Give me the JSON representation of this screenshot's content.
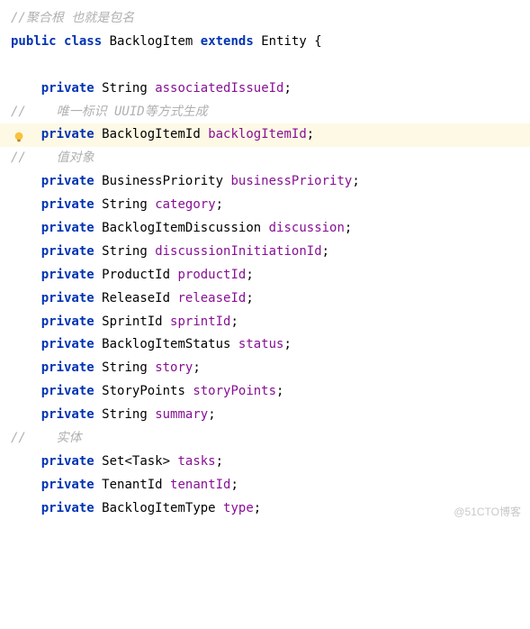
{
  "comments": {
    "line1": "//聚合根 也就是包名",
    "line2": "//    唯一标识 UUID等方式生成",
    "line3": "//    值对象",
    "line4": "//    实体"
  },
  "keywords": {
    "public": "public",
    "class": "class",
    "extends": "extends",
    "private": "private"
  },
  "types": {
    "String": "String",
    "BacklogItemId": "BacklogItemId",
    "BusinessPriority": "BusinessPriority",
    "BacklogItemDiscussion": "BacklogItemDiscussion",
    "ProductId": "ProductId",
    "ReleaseId": "ReleaseId",
    "SprintId": "SprintId",
    "BacklogItemStatus": "BacklogItemStatus",
    "StoryPoints": "StoryPoints",
    "SetTask": "Set<Task>",
    "TenantId": "TenantId",
    "BacklogItemType": "BacklogItemType"
  },
  "classnames": {
    "BacklogItem": "BacklogItem",
    "Entity": "Entity"
  },
  "fields": {
    "associatedIssueId": "associatedIssueId",
    "backlogItemId": "backlogItemId",
    "businessPriority": "businessPriority",
    "category": "category",
    "discussion": "discussion",
    "discussionInitiationId": "discussionInitiationId",
    "productId": "productId",
    "releaseId": "releaseId",
    "sprintId": "sprintId",
    "status": "status",
    "story": "story",
    "storyPoints": "storyPoints",
    "summary": "summary",
    "tasks": "tasks",
    "tenantId": "tenantId",
    "type": "type"
  },
  "symbols": {
    "openBrace": "{",
    "semicolon": ";"
  },
  "attribution": "@51CTO博客",
  "icons": {
    "bulb": "bulb-icon"
  }
}
